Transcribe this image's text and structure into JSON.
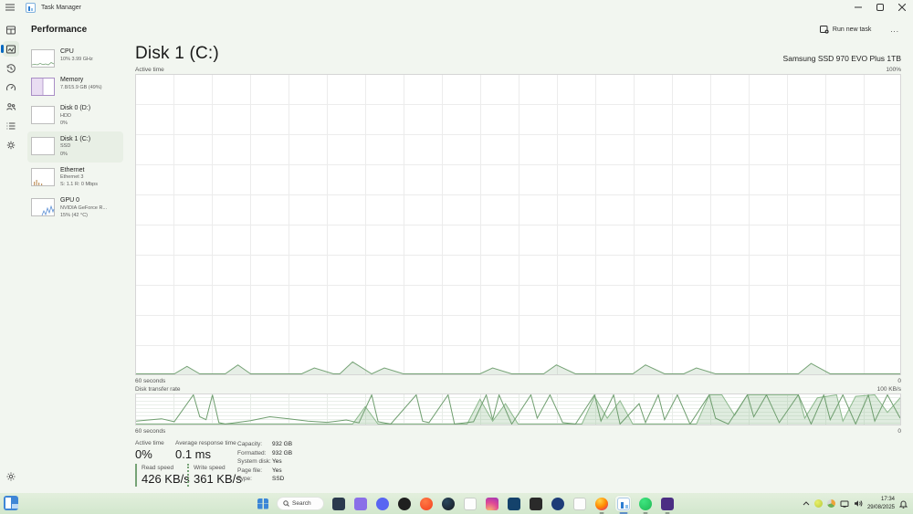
{
  "header": {
    "app_title": "Task Manager"
  },
  "page": {
    "title": "Performance"
  },
  "toolbar": {
    "run_new_task": "Run new task",
    "more": "..."
  },
  "nav_rail": {
    "items": [
      "processes",
      "performance",
      "app-history",
      "startup-apps",
      "users",
      "details",
      "services"
    ],
    "selected": "performance",
    "settings": "settings"
  },
  "perf_list": {
    "items": [
      {
        "name": "CPU",
        "line2": "10% 3.99 GHz"
      },
      {
        "name": "Memory",
        "line2": "7.8/15.9 GB (49%)"
      },
      {
        "name": "Disk 0 (D:)",
        "line2": "HDD",
        "line3": "0%"
      },
      {
        "name": "Disk 1 (C:)",
        "line2": "SSD",
        "line3": "0%"
      },
      {
        "name": "Ethernet",
        "line2": "Ethernet 3",
        "line3": "S: 1.1 R: 0 Mbps"
      },
      {
        "name": "GPU 0",
        "line2": "NVIDIA GeForce R...",
        "line3": "15% (42 °C)"
      }
    ],
    "selected_index": 3
  },
  "main": {
    "title": "Disk 1 (C:)",
    "device": "Samsung SSD 970 EVO Plus 1TB",
    "active_time_label": "Active time",
    "active_time_ymax": "100%",
    "active_time_xlabel": "60 seconds",
    "active_time_ymin": "0",
    "transfer_label": "Disk transfer rate",
    "transfer_ymax": "100 KB/s",
    "transfer_xlabel": "60 seconds",
    "transfer_ymin": "0",
    "stats": {
      "active_time_label": "Active time",
      "active_time_value": "0%",
      "avg_response_label": "Average response time",
      "avg_response_value": "0.1 ms",
      "read_label": "Read speed",
      "read_value": "426 KB/s",
      "write_label": "Write speed",
      "write_value": "361 KB/s",
      "info": [
        {
          "label": "Capacity:",
          "value": "932 GB"
        },
        {
          "label": "Formatted:",
          "value": "932 GB"
        },
        {
          "label": "System disk:",
          "value": "Yes"
        },
        {
          "label": "Page file:",
          "value": "Yes"
        },
        {
          "label": "Type:",
          "value": "SSD"
        }
      ]
    }
  },
  "chart_data": [
    {
      "type": "area",
      "title": "Active time",
      "xlabel": "60 seconds",
      "ylabel": "Active time (%)",
      "xlim": [
        0,
        60
      ],
      "ylim": [
        0,
        100
      ],
      "y_axis_labels": [
        "100%",
        "0"
      ],
      "grid": true,
      "series": [
        {
          "name": "Active time",
          "color": "#76a376",
          "fill": "rgba(118,163,118,0.18)",
          "points": [
            [
              0,
              0
            ],
            [
              3,
              0
            ],
            [
              4,
              2.5
            ],
            [
              5,
              0
            ],
            [
              7,
              0
            ],
            [
              8,
              3
            ],
            [
              9,
              0
            ],
            [
              13,
              0
            ],
            [
              14,
              2
            ],
            [
              15.5,
              0
            ],
            [
              16,
              0
            ],
            [
              17,
              4
            ],
            [
              18.5,
              0
            ],
            [
              19.5,
              2
            ],
            [
              21,
              0
            ],
            [
              27,
              0
            ],
            [
              28,
              2
            ],
            [
              29.5,
              0
            ],
            [
              32,
              0
            ],
            [
              33,
              3
            ],
            [
              34.5,
              0
            ],
            [
              39,
              0
            ],
            [
              40,
              3
            ],
            [
              41.5,
              0
            ],
            [
              43,
              0
            ],
            [
              44,
              2
            ],
            [
              45.5,
              0
            ],
            [
              52,
              0
            ],
            [
              53,
              3.5
            ],
            [
              54.5,
              0
            ],
            [
              60,
              0
            ]
          ]
        }
      ]
    },
    {
      "type": "area",
      "title": "Disk transfer rate",
      "xlabel": "60 seconds",
      "ylabel": "KB/s",
      "xlim": [
        0,
        60
      ],
      "ylim": [
        0,
        100
      ],
      "y_axis_labels": [
        "100 KB/s",
        "0"
      ],
      "grid": true,
      "series": [
        {
          "name": "Write speed",
          "color": "#8cb98c",
          "fill": "rgba(140,185,140,0.28)",
          "points": [
            [
              0,
              0
            ],
            [
              17,
              0
            ],
            [
              18,
              60
            ],
            [
              19,
              0
            ],
            [
              26,
              0
            ],
            [
              27,
              85
            ],
            [
              28,
              10
            ],
            [
              29,
              70
            ],
            [
              30,
              0
            ],
            [
              35,
              0
            ],
            [
              36,
              95
            ],
            [
              37,
              20
            ],
            [
              38,
              80
            ],
            [
              39,
              0
            ],
            [
              44,
              0
            ],
            [
              45,
              100
            ],
            [
              46,
              100
            ],
            [
              47,
              30
            ],
            [
              48,
              100
            ],
            [
              52,
              100
            ],
            [
              52.5,
              20
            ],
            [
              53.5,
              90
            ],
            [
              55,
              100
            ],
            [
              55.5,
              10
            ],
            [
              56.5,
              95
            ],
            [
              58,
              100
            ],
            [
              59,
              40
            ],
            [
              60,
              90
            ]
          ]
        },
        {
          "name": "Read speed",
          "color": "#6f9e6f",
          "fill": "none",
          "points": [
            [
              0,
              10
            ],
            [
              2,
              18
            ],
            [
              3,
              8
            ],
            [
              4.5,
              100
            ],
            [
              5,
              25
            ],
            [
              5.5,
              15
            ],
            [
              6,
              100
            ],
            [
              6.5,
              5
            ],
            [
              7,
              0
            ],
            [
              9,
              12
            ],
            [
              10.5,
              25
            ],
            [
              12,
              18
            ],
            [
              13.5,
              10
            ],
            [
              15,
              6
            ],
            [
              16.5,
              14
            ],
            [
              17.5,
              4
            ],
            [
              18.5,
              100
            ],
            [
              19,
              8
            ],
            [
              20,
              0
            ],
            [
              22,
              100
            ],
            [
              22.5,
              10
            ],
            [
              23,
              5
            ],
            [
              24.5,
              100
            ],
            [
              25,
              0
            ],
            [
              26.5,
              8
            ],
            [
              27.5,
              100
            ],
            [
              28,
              15
            ],
            [
              28.5,
              100
            ],
            [
              29.5,
              0
            ],
            [
              31,
              100
            ],
            [
              31.5,
              20
            ],
            [
              32.5,
              100
            ],
            [
              33.5,
              5
            ],
            [
              34.5,
              0
            ],
            [
              36,
              100
            ],
            [
              36.5,
              10
            ],
            [
              37.5,
              100
            ],
            [
              38,
              0
            ],
            [
              39.5,
              70
            ],
            [
              40,
              5
            ],
            [
              41,
              100
            ],
            [
              41.5,
              15
            ],
            [
              42.5,
              100
            ],
            [
              43.5,
              0
            ],
            [
              45,
              100
            ],
            [
              45.5,
              20
            ],
            [
              46.5,
              0
            ],
            [
              48,
              100
            ],
            [
              48.5,
              25
            ],
            [
              49.5,
              100
            ],
            [
              50.5,
              5
            ],
            [
              52,
              100
            ],
            [
              53,
              0
            ],
            [
              54,
              100
            ],
            [
              54.5,
              15
            ],
            [
              55.5,
              100
            ],
            [
              56.5,
              0
            ],
            [
              57.5,
              100
            ],
            [
              58,
              10
            ],
            [
              59,
              100
            ],
            [
              60,
              20
            ]
          ]
        }
      ]
    }
  ],
  "taskbar": {
    "search_label": "Search",
    "apps": [
      {
        "name": "file-explorer",
        "bg": "#2b3a4d",
        "shape": "square"
      },
      {
        "name": "chat",
        "bg": "#8a6fe8",
        "shape": "square"
      },
      {
        "name": "discord",
        "bg": "#5865f2",
        "shape": "circle"
      },
      {
        "name": "dark-app",
        "bg": "#1f1f1f",
        "shape": "circle"
      },
      {
        "name": "brave",
        "bg": "radial-gradient(circle at 40% 30%, #ff7a45, #f4401f)",
        "shape": "circle"
      },
      {
        "name": "steam",
        "bg": "radial-gradient(circle at 35% 30%, #2a475e, #171a21)",
        "shape": "circle"
      },
      {
        "name": "notepad",
        "bg": "#fdfdfd",
        "shape": "square",
        "border": true
      },
      {
        "name": "instagram",
        "bg": "radial-gradient(circle at 30% 110%, #fdc468, #df4996 55%, #9b36b7)",
        "shape": "square"
      },
      {
        "name": "battlenet",
        "bg": "#14426b",
        "shape": "square"
      },
      {
        "name": "epic-games",
        "bg": "#2a2a2a",
        "shape": "square"
      },
      {
        "name": "blue-app",
        "bg": "#1e3c78",
        "shape": "circle"
      },
      {
        "name": "document",
        "bg": "#fdfdfd",
        "shape": "square",
        "border": true
      },
      {
        "name": "firefox",
        "bg": "radial-gradient(circle at 35% 25%, #ffd54a, #ff8a00 50%, #e1227d 95%)",
        "shape": "circle",
        "running": true
      },
      {
        "name": "task-manager",
        "bg": "#ffffff",
        "shape": "square",
        "active": true,
        "running": true
      },
      {
        "name": "whatsapp",
        "bg": "radial-gradient(circle at 35% 30%, #3ee57f, #1fb855)",
        "shape": "circle",
        "running": true
      },
      {
        "name": "app-purple",
        "bg": "#4b2e83",
        "shape": "square",
        "running": true
      }
    ],
    "tray": {
      "time": "17:34",
      "date": "29/08/2025"
    }
  },
  "colors": {
    "accent": "#0067c0",
    "chart_green_line": "#76a376",
    "chart_green_fill": "#e6f0e6",
    "memory_purple": "#a98ec6",
    "app_background": "#f2f6f0",
    "selected_item": "#e8efe5"
  }
}
